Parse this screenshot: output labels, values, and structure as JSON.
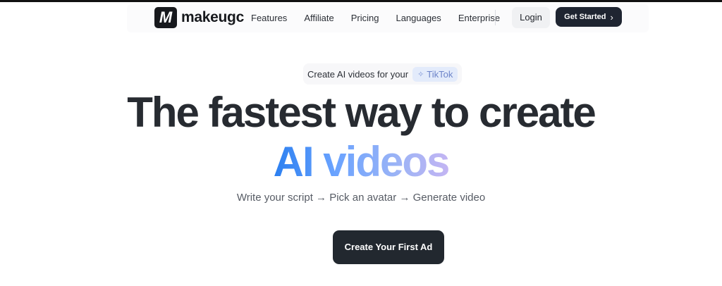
{
  "brand": {
    "logo_letter": "M",
    "name": "makeugc"
  },
  "nav": {
    "links": [
      "Features",
      "Affiliate",
      "Pricing",
      "Languages",
      "Enterprise"
    ],
    "login_label": "Login",
    "get_started_label": "Get Started",
    "get_started_chevron": "›"
  },
  "hero": {
    "pill_text": "Create AI videos for your",
    "pill_chip_icon": "sparkle-icon",
    "pill_chip_label": "TikTok",
    "headline_line1": "The fastest way to create",
    "headline_line2": "AI videos",
    "subtitle": "Write your script → Pick an avatar → Generate video",
    "cta_label": "Create Your First Ad"
  },
  "colors": {
    "primary_dark": "#1f2531",
    "gradient_start": "#2b7ff0",
    "gradient_end": "#c3b5f3",
    "chip_bg": "#e3ebfb"
  }
}
